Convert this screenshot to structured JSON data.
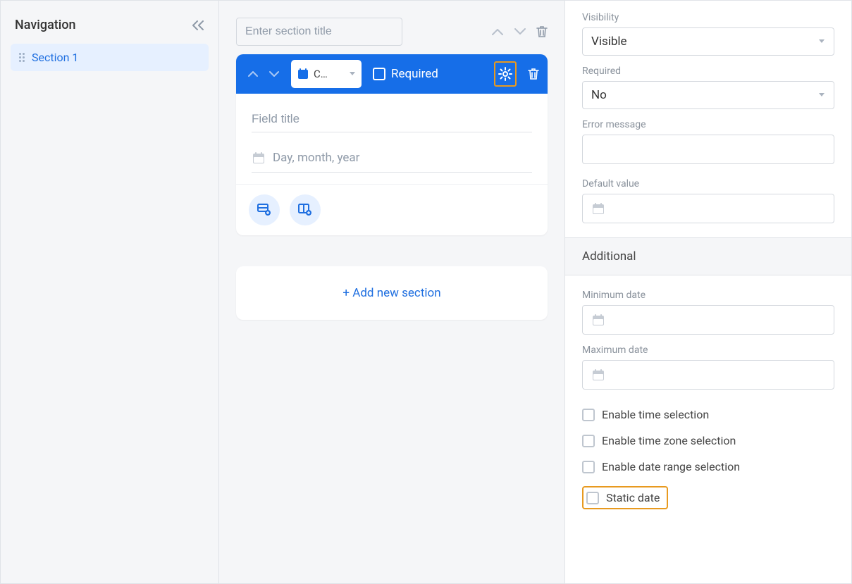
{
  "sidebar": {
    "title": "Navigation",
    "items": [
      {
        "label": "Section 1"
      }
    ]
  },
  "canvas": {
    "section_title_placeholder": "Enter section title",
    "field": {
      "type_label": "C…",
      "required_label": "Required",
      "field_title_placeholder": "Field title",
      "date_preview": "Day, month, year"
    },
    "add_section_label": "+ Add new section"
  },
  "props": {
    "visibility_label": "Visibility",
    "visibility_value": "Visible",
    "required_label": "Required",
    "required_value": "No",
    "error_message_label": "Error message",
    "default_value_label": "Default value",
    "additional_label": "Additional",
    "min_date_label": "Minimum date",
    "max_date_label": "Maximum date",
    "enable_time_label": "Enable time selection",
    "enable_tz_label": "Enable time zone selection",
    "enable_range_label": "Enable date range selection",
    "static_date_label": "Static date"
  }
}
